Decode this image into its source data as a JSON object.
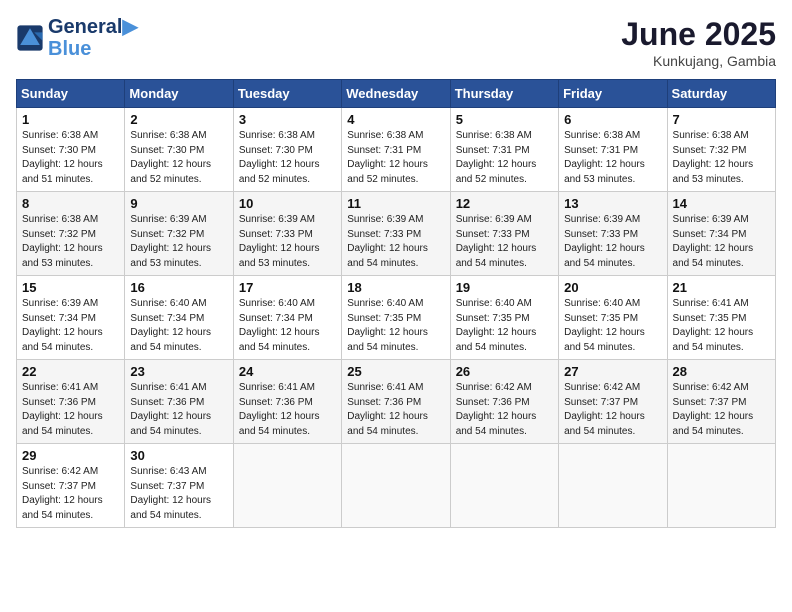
{
  "logo": {
    "line1": "General",
    "line2": "Blue"
  },
  "title": "June 2025",
  "subtitle": "Kunkujang, Gambia",
  "headers": [
    "Sunday",
    "Monday",
    "Tuesday",
    "Wednesday",
    "Thursday",
    "Friday",
    "Saturday"
  ],
  "weeks": [
    [
      {
        "day": "1",
        "info": "Sunrise: 6:38 AM\nSunset: 7:30 PM\nDaylight: 12 hours\nand 51 minutes."
      },
      {
        "day": "2",
        "info": "Sunrise: 6:38 AM\nSunset: 7:30 PM\nDaylight: 12 hours\nand 52 minutes."
      },
      {
        "day": "3",
        "info": "Sunrise: 6:38 AM\nSunset: 7:30 PM\nDaylight: 12 hours\nand 52 minutes."
      },
      {
        "day": "4",
        "info": "Sunrise: 6:38 AM\nSunset: 7:31 PM\nDaylight: 12 hours\nand 52 minutes."
      },
      {
        "day": "5",
        "info": "Sunrise: 6:38 AM\nSunset: 7:31 PM\nDaylight: 12 hours\nand 52 minutes."
      },
      {
        "day": "6",
        "info": "Sunrise: 6:38 AM\nSunset: 7:31 PM\nDaylight: 12 hours\nand 53 minutes."
      },
      {
        "day": "7",
        "info": "Sunrise: 6:38 AM\nSunset: 7:32 PM\nDaylight: 12 hours\nand 53 minutes."
      }
    ],
    [
      {
        "day": "8",
        "info": "Sunrise: 6:38 AM\nSunset: 7:32 PM\nDaylight: 12 hours\nand 53 minutes."
      },
      {
        "day": "9",
        "info": "Sunrise: 6:39 AM\nSunset: 7:32 PM\nDaylight: 12 hours\nand 53 minutes."
      },
      {
        "day": "10",
        "info": "Sunrise: 6:39 AM\nSunset: 7:33 PM\nDaylight: 12 hours\nand 53 minutes."
      },
      {
        "day": "11",
        "info": "Sunrise: 6:39 AM\nSunset: 7:33 PM\nDaylight: 12 hours\nand 54 minutes."
      },
      {
        "day": "12",
        "info": "Sunrise: 6:39 AM\nSunset: 7:33 PM\nDaylight: 12 hours\nand 54 minutes."
      },
      {
        "day": "13",
        "info": "Sunrise: 6:39 AM\nSunset: 7:33 PM\nDaylight: 12 hours\nand 54 minutes."
      },
      {
        "day": "14",
        "info": "Sunrise: 6:39 AM\nSunset: 7:34 PM\nDaylight: 12 hours\nand 54 minutes."
      }
    ],
    [
      {
        "day": "15",
        "info": "Sunrise: 6:39 AM\nSunset: 7:34 PM\nDaylight: 12 hours\nand 54 minutes."
      },
      {
        "day": "16",
        "info": "Sunrise: 6:40 AM\nSunset: 7:34 PM\nDaylight: 12 hours\nand 54 minutes."
      },
      {
        "day": "17",
        "info": "Sunrise: 6:40 AM\nSunset: 7:34 PM\nDaylight: 12 hours\nand 54 minutes."
      },
      {
        "day": "18",
        "info": "Sunrise: 6:40 AM\nSunset: 7:35 PM\nDaylight: 12 hours\nand 54 minutes."
      },
      {
        "day": "19",
        "info": "Sunrise: 6:40 AM\nSunset: 7:35 PM\nDaylight: 12 hours\nand 54 minutes."
      },
      {
        "day": "20",
        "info": "Sunrise: 6:40 AM\nSunset: 7:35 PM\nDaylight: 12 hours\nand 54 minutes."
      },
      {
        "day": "21",
        "info": "Sunrise: 6:41 AM\nSunset: 7:35 PM\nDaylight: 12 hours\nand 54 minutes."
      }
    ],
    [
      {
        "day": "22",
        "info": "Sunrise: 6:41 AM\nSunset: 7:36 PM\nDaylight: 12 hours\nand 54 minutes."
      },
      {
        "day": "23",
        "info": "Sunrise: 6:41 AM\nSunset: 7:36 PM\nDaylight: 12 hours\nand 54 minutes."
      },
      {
        "day": "24",
        "info": "Sunrise: 6:41 AM\nSunset: 7:36 PM\nDaylight: 12 hours\nand 54 minutes."
      },
      {
        "day": "25",
        "info": "Sunrise: 6:41 AM\nSunset: 7:36 PM\nDaylight: 12 hours\nand 54 minutes."
      },
      {
        "day": "26",
        "info": "Sunrise: 6:42 AM\nSunset: 7:36 PM\nDaylight: 12 hours\nand 54 minutes."
      },
      {
        "day": "27",
        "info": "Sunrise: 6:42 AM\nSunset: 7:37 PM\nDaylight: 12 hours\nand 54 minutes."
      },
      {
        "day": "28",
        "info": "Sunrise: 6:42 AM\nSunset: 7:37 PM\nDaylight: 12 hours\nand 54 minutes."
      }
    ],
    [
      {
        "day": "29",
        "info": "Sunrise: 6:42 AM\nSunset: 7:37 PM\nDaylight: 12 hours\nand 54 minutes."
      },
      {
        "day": "30",
        "info": "Sunrise: 6:43 AM\nSunset: 7:37 PM\nDaylight: 12 hours\nand 54 minutes."
      },
      {
        "day": "",
        "info": ""
      },
      {
        "day": "",
        "info": ""
      },
      {
        "day": "",
        "info": ""
      },
      {
        "day": "",
        "info": ""
      },
      {
        "day": "",
        "info": ""
      }
    ]
  ]
}
